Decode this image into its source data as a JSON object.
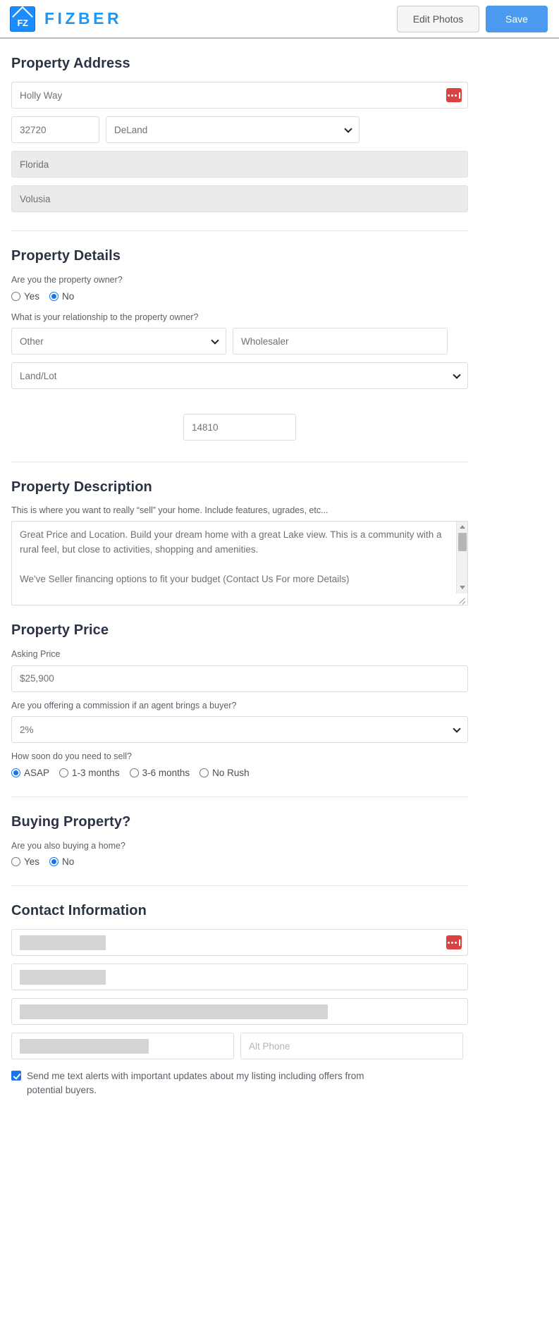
{
  "header": {
    "logo_text": "FZ",
    "brand_name": "FIZBER",
    "edit_photos_label": "Edit Photos",
    "save_label": "Save",
    "accent_color": "#4a9bf0",
    "brand_color": "#2196f3"
  },
  "property_address": {
    "title": "Property Address",
    "street": "Holly Way",
    "zip": "32720",
    "city": "DeLand",
    "state": "Florida",
    "county": "Volusia",
    "autofill_icon": "lastpass-icon"
  },
  "property_details": {
    "title": "Property Details",
    "owner_question": "Are you the property owner?",
    "owner_options": [
      {
        "label": "Yes",
        "selected": false
      },
      {
        "label": "No",
        "selected": true
      }
    ],
    "relationship_question": "What is your relationship to the property owner?",
    "relationship_value": "Other",
    "relationship_other_value": "Wholesaler",
    "property_type_value": "Land/Lot",
    "lot_size_value": "14810"
  },
  "property_description": {
    "title": "Property Description",
    "help_text": "This is where you want to really “sell” your home. Include features, ugrades, etc...",
    "text": "Great Price and Location. Build your dream home with a great Lake view. This is a community with a rural feel, but close to activities, shopping and amenities.\n\nWe've Seller financing options to fit your budget (Contact Us For more Details)\n\n· Community: Forest Hills\n· Featured:"
  },
  "property_price": {
    "title": "Property Price",
    "asking_price_label": "Asking Price",
    "asking_price_value": "$25,900",
    "commission_question": "Are you offering a commission if an agent brings a buyer?",
    "commission_value": "2%",
    "timeline_question": "How soon do you need to sell?",
    "timeline_options": [
      {
        "label": "ASAP",
        "selected": true
      },
      {
        "label": "1-3 months",
        "selected": false
      },
      {
        "label": "3-6 months",
        "selected": false
      },
      {
        "label": "No Rush",
        "selected": false
      }
    ]
  },
  "buying_property": {
    "title": "Buying Property?",
    "question": "Are you also buying a home?",
    "options": [
      {
        "label": "Yes",
        "selected": false
      },
      {
        "label": "No",
        "selected": true
      }
    ]
  },
  "contact_information": {
    "title": "Contact Information",
    "first_name_redacted": true,
    "last_name_redacted": true,
    "email_redacted": true,
    "phone_redacted": true,
    "alt_phone_placeholder": "Alt Phone",
    "autofill_icon": "lastpass-icon",
    "text_alerts_label": "Send me text alerts with important updates about my listing including offers from potential buyers.",
    "text_alerts_checked": true
  }
}
